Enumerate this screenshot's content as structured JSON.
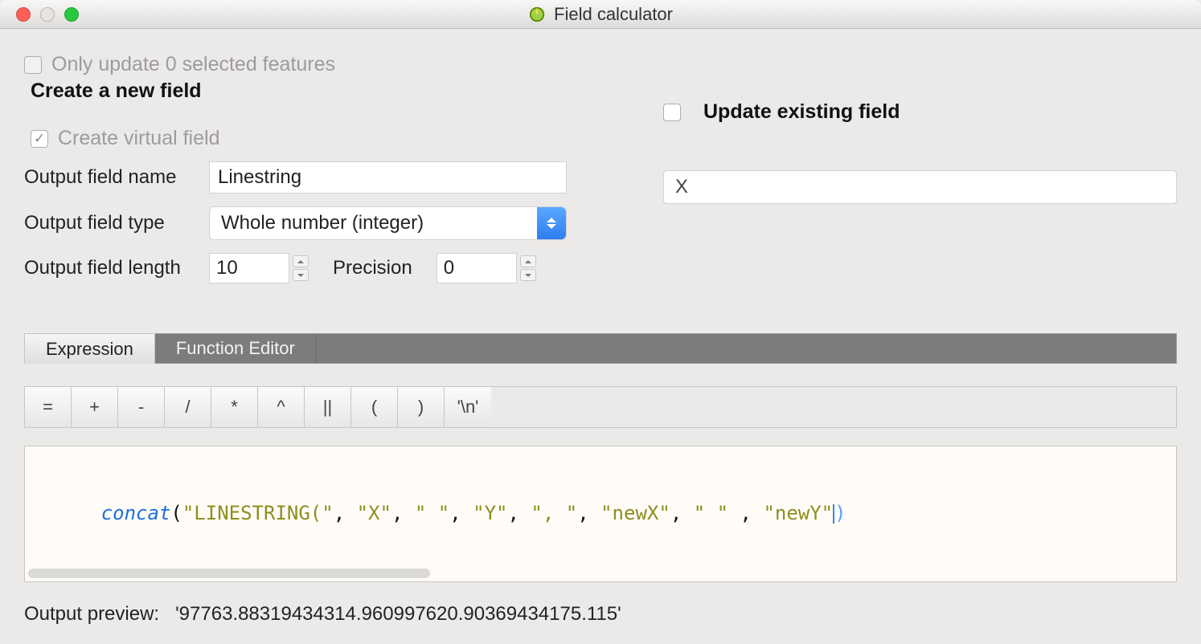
{
  "window": {
    "title": "Field calculator"
  },
  "top": {
    "only_update_label": "Only update 0 selected features",
    "create_new_field_label": "Create a new field",
    "create_virtual_field_label": "Create virtual field",
    "create_virtual_field_checked": true
  },
  "left": {
    "output_field_name_label": "Output field name",
    "output_field_name_value": "Linestring",
    "output_field_type_label": "Output field type",
    "output_field_type_value": "Whole number (integer)",
    "output_field_length_label": "Output field length",
    "output_field_length_value": "10",
    "precision_label": "Precision",
    "precision_value": "0"
  },
  "right": {
    "update_existing_label": "Update existing field",
    "existing_field_value": "X"
  },
  "tabs": {
    "expression": "Expression",
    "function_editor": "Function Editor"
  },
  "ops": [
    "=",
    "+",
    "-",
    "/",
    "*",
    "^",
    "||",
    "(",
    ")",
    "'\\n'"
  ],
  "expression": {
    "fn": "concat",
    "open": "(",
    "tokens": [
      "\"LINESTRING(\"",
      ", ",
      "\"X\"",
      ", ",
      "\" \"",
      ", ",
      "\"Y\"",
      ", ",
      "\", \"",
      ", ",
      "\"newX\"",
      ", ",
      "\" \"",
      " , ",
      "\"newY\""
    ],
    "close": ")"
  },
  "preview": {
    "label": "Output preview:",
    "value": "'97763.88319434314.960997620.90369434175.115'"
  }
}
